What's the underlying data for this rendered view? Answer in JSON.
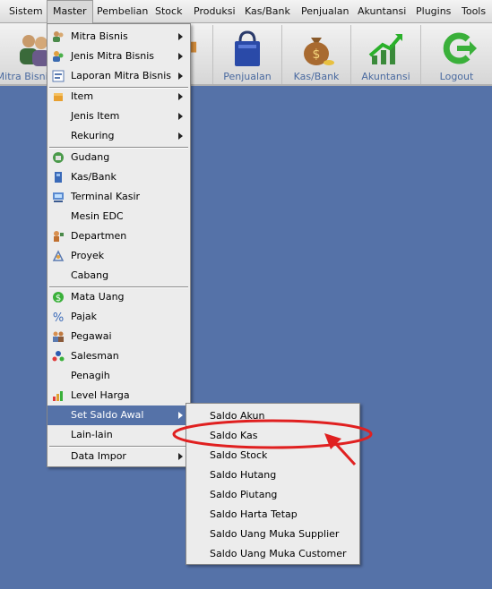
{
  "menubar": {
    "items": [
      {
        "label": "Sistem",
        "u": "y",
        "rest": "stem",
        "pre": "Si"
      },
      {
        "label": "Master"
      },
      {
        "label": "Pembelian"
      },
      {
        "label": "Stock"
      },
      {
        "label": "Produksi"
      },
      {
        "label": "Kas/Bank"
      },
      {
        "label": "Penjualan"
      },
      {
        "label": "Akuntansi"
      },
      {
        "label": "Plugins"
      },
      {
        "label": "Tools"
      }
    ]
  },
  "toolbar": {
    "buttons": [
      {
        "label": "Mitra Bisnis"
      },
      {
        "label": "Penjualan"
      },
      {
        "label": "Kas/Bank"
      },
      {
        "label": "Akuntansi"
      },
      {
        "label": "Logout"
      }
    ]
  },
  "master_menu": {
    "items": [
      {
        "label": "Mitra Bisnis"
      },
      {
        "label": "Jenis Mitra Bisnis"
      },
      {
        "label": "Laporan Mitra Bisnis"
      },
      {
        "label": "Item"
      },
      {
        "label": "Jenis Item"
      },
      {
        "label": "Rekuring"
      },
      {
        "label": "Gudang"
      },
      {
        "label": "Kas/Bank"
      },
      {
        "label": "Terminal Kasir"
      },
      {
        "label": "Mesin EDC"
      },
      {
        "label": "Departmen"
      },
      {
        "label": "Proyek"
      },
      {
        "label": "Cabang"
      },
      {
        "label": "Mata Uang"
      },
      {
        "label": "Pajak"
      },
      {
        "label": "Pegawai"
      },
      {
        "label": "Salesman"
      },
      {
        "label": "Penagih"
      },
      {
        "label": "Level Harga"
      },
      {
        "label": "Set Saldo Awal"
      },
      {
        "label": "Lain-lain"
      },
      {
        "label": "Data Impor"
      }
    ]
  },
  "saldo_submenu": {
    "items": [
      {
        "label": "Saldo Akun"
      },
      {
        "label": "Saldo Kas"
      },
      {
        "label": "Saldo Stock"
      },
      {
        "label": "Saldo Hutang"
      },
      {
        "label": "Saldo Piutang"
      },
      {
        "label": "Saldo Harta Tetap"
      },
      {
        "label": "Saldo Uang Muka Supplier"
      },
      {
        "label": "Saldo Uang Muka Customer"
      }
    ]
  },
  "colors": {
    "desktop": "#5572a8",
    "highlight": "#5572a8",
    "annotation": "#e02020"
  }
}
